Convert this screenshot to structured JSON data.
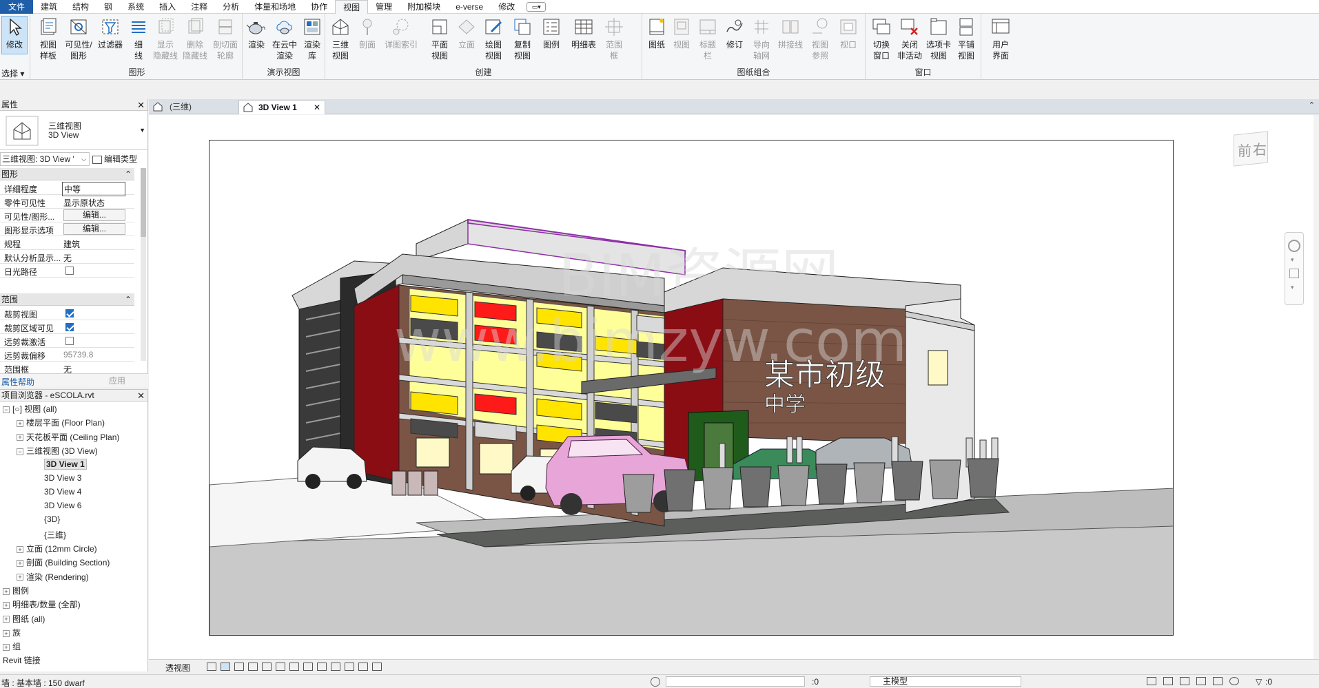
{
  "menu": {
    "items": [
      "文件",
      "建筑",
      "结构",
      "钢",
      "系统",
      "插入",
      "注释",
      "分析",
      "体量和场地",
      "协作",
      "视图",
      "管理",
      "附加模块",
      "e-verse",
      "修改"
    ],
    "active_index": 10
  },
  "ribbon": {
    "select": {
      "modify": "修改",
      "select_label": "选择"
    },
    "graphics": {
      "panel_label": "图形",
      "view_template": "视图\n样板",
      "visibility": "可见性/\n图形",
      "filters": "过滤器",
      "thin_lines": "细\n线",
      "show_hidden": "显示\n隐藏线",
      "remove_hidden": "删除\n隐藏线",
      "cut_profile": "剖切面\n轮廓"
    },
    "presentation": {
      "panel_label": "演示视图",
      "render": "渲染",
      "cloud_render": "在云中\n渲染",
      "render_gallery": "渲染\n库"
    },
    "create": {
      "panel_label": "创建",
      "threed": "三维\n视图",
      "section": "剖面",
      "callout": "详图索引",
      "plan": "平面\n视图",
      "elevation": "立面",
      "drafting": "绘图\n视图",
      "duplicate": "复制\n视图",
      "legend": "图例",
      "schedule": "明细表",
      "scope": "范围\n框"
    },
    "sheet": {
      "panel_label": "图纸组合",
      "sheet": "图纸",
      "view": "视图",
      "titleblock": "标题\n栏",
      "revision": "修订",
      "guide_grid": "导向\n轴网",
      "matchline": "拼接线",
      "view_ref": "视图\n参照",
      "viewport": "视口"
    },
    "windows": {
      "panel_label": "窗口",
      "switch": "切换\n窗口",
      "close_inactive": "关闭\n非活动",
      "tab_views": "选项卡\n视图",
      "tile_views": "平铺\n视图"
    },
    "ui": {
      "user_interface": "用户\n界面"
    }
  },
  "properties": {
    "title": "属性",
    "type_name": "三维视图",
    "type_sub": "3D View",
    "selector": "三维视图: 3D View '",
    "edit_type": "编辑类型",
    "group_graphics": "图形",
    "rows_graphics": [
      {
        "k": "详细程度",
        "v": "中等"
      },
      {
        "k": "零件可见性",
        "v": "显示原状态"
      },
      {
        "k": "可见性/图形...",
        "v": "编辑..."
      },
      {
        "k": "图形显示选项",
        "v": "编辑..."
      },
      {
        "k": "规程",
        "v": "建筑"
      },
      {
        "k": "默认分析显示...",
        "v": "无"
      },
      {
        "k": "日光路径",
        "v": ""
      }
    ],
    "group_extents": "范围",
    "rows_extents": [
      {
        "k": "裁剪视图",
        "v": ""
      },
      {
        "k": "裁剪区域可见",
        "v": ""
      },
      {
        "k": "远剪裁激活",
        "v": ""
      },
      {
        "k": "远剪裁偏移",
        "v": "95739.8"
      },
      {
        "k": "范围框",
        "v": "无"
      }
    ],
    "help": "属性帮助",
    "apply": "应用"
  },
  "browser": {
    "title": "项目浏览器 - eSCOLA.rvt",
    "nodes": [
      {
        "t": "[○] 视图 (all)",
        "lvl": 0,
        "tog": "−"
      },
      {
        "t": "楼层平面 (Floor Plan)",
        "lvl": 1,
        "tog": "+"
      },
      {
        "t": "天花板平面 (Ceiling Plan)",
        "lvl": 1,
        "tog": "+"
      },
      {
        "t": "三维视图 (3D View)",
        "lvl": 1,
        "tog": "−"
      },
      {
        "t": "3D View 1",
        "lvl": 2,
        "tog": "",
        "sel": true
      },
      {
        "t": "3D View 3",
        "lvl": 2,
        "tog": ""
      },
      {
        "t": "3D View 4",
        "lvl": 2,
        "tog": ""
      },
      {
        "t": "3D View 6",
        "lvl": 2,
        "tog": ""
      },
      {
        "t": "{3D}",
        "lvl": 2,
        "tog": ""
      },
      {
        "t": "{三维}",
        "lvl": 2,
        "tog": ""
      },
      {
        "t": "立面 (12mm Circle)",
        "lvl": 1,
        "tog": "+"
      },
      {
        "t": "剖面 (Building Section)",
        "lvl": 1,
        "tog": "+"
      },
      {
        "t": "渲染 (Rendering)",
        "lvl": 1,
        "tog": "+"
      },
      {
        "t": "图例",
        "lvl": 0,
        "tog": "+"
      },
      {
        "t": "明细表/数量 (全部)",
        "lvl": 0,
        "tog": "+"
      },
      {
        "t": "图纸 (all)",
        "lvl": 0,
        "tog": "+"
      },
      {
        "t": "族",
        "lvl": 0,
        "tog": "+"
      },
      {
        "t": "组",
        "lvl": 0,
        "tog": "+"
      },
      {
        "t": "Revit 链接",
        "lvl": 0,
        "tog": ""
      }
    ]
  },
  "tabs": [
    {
      "label": "(三维)",
      "active": false
    },
    {
      "label": "3D View 1",
      "active": true
    }
  ],
  "viewcube": {
    "front": "前",
    "right": "右"
  },
  "scene": {
    "sign_line1": "某市初级",
    "sign_line2": "中学",
    "watermark1": "BIM资源网",
    "watermark2": "www.bimzyw.com"
  },
  "viewbar": {
    "mode": "透视图"
  },
  "status": {
    "left": "墙 : 基本墙 : 150 dwarf",
    "coord": ":0",
    "model": "主模型",
    "filter": ":0"
  },
  "colors": {
    "accent": "#1f5fa9",
    "wall_red": "#8a0d14",
    "brick": "#7a5545",
    "panel_red": "#ff1a1a",
    "panel_yellow": "#ffe400",
    "glass_yellow": "#ffff99"
  }
}
